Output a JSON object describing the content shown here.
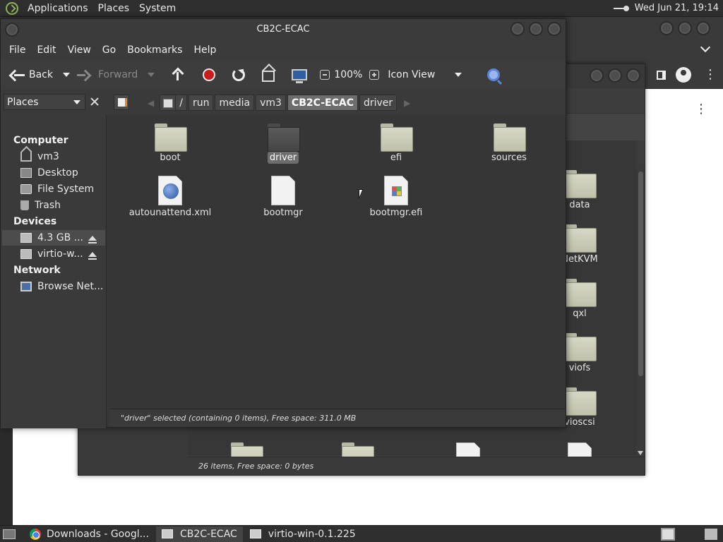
{
  "top_panel": {
    "menus": [
      "Applications",
      "Places",
      "System"
    ],
    "clock": "Wed Jun 21, 19:14"
  },
  "main_window": {
    "title": "CB2C-ECAC",
    "menubar": [
      "File",
      "Edit",
      "View",
      "Go",
      "Bookmarks",
      "Help"
    ],
    "toolbar": {
      "back_label": "Back",
      "forward_label": "Forward",
      "zoom": "100%",
      "view_mode": "Icon View"
    },
    "sidebar_selector": "Places",
    "breadcrumb": [
      "/",
      "run",
      "media",
      "vm3",
      "CB2C-ECAC",
      "driver"
    ],
    "sidebar": {
      "sections": [
        {
          "title": "Computer",
          "items": [
            "vm3",
            "Desktop",
            "File System",
            "Trash"
          ]
        },
        {
          "title": "Devices",
          "items": [
            "4.3 GB ...",
            "virtio-w..."
          ]
        },
        {
          "title": "Network",
          "items": [
            "Browse Net..."
          ]
        }
      ]
    },
    "items": [
      {
        "name": "boot",
        "type": "folder"
      },
      {
        "name": "driver",
        "type": "folder",
        "selected": true
      },
      {
        "name": "efi",
        "type": "folder"
      },
      {
        "name": "sources",
        "type": "folder"
      },
      {
        "name": "autounattend.xml",
        "type": "xml"
      },
      {
        "name": "bootmgr",
        "type": "file"
      },
      {
        "name": "bootmgr.efi",
        "type": "efi"
      }
    ],
    "status": "\"driver\" selected (containing 0 items), Free space: 311.0 MB"
  },
  "back_window": {
    "items": [
      "data",
      "NetKVM",
      "qxl",
      "viofs",
      "vioscsi"
    ],
    "status": "26 items, Free space: 0 bytes"
  },
  "taskbar": {
    "tasks": [
      "Downloads - Googl...",
      "CB2C-ECAC",
      "virtio-win-0.1.225"
    ]
  },
  "colors": {
    "selection": "#6d6d6d",
    "stop_icon": "#cc1b1b",
    "folder": "#d6d8c6"
  }
}
